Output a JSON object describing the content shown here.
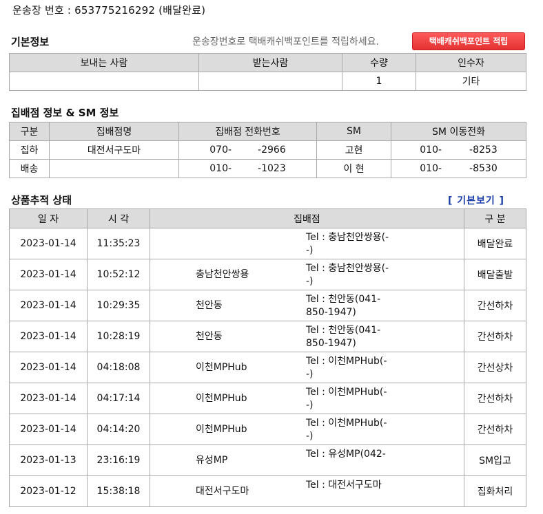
{
  "waybill": {
    "label": "운송장 번호 :",
    "number": "653775216292",
    "status": "(배달완료)"
  },
  "basic": {
    "title": "기본정보",
    "note": "운송장번호로 택배캐쉬백포인트를 적립하세요.",
    "button": "택배캐쉬백포인트 적립",
    "headers": [
      "보내는 사람",
      "받는사람",
      "수량",
      "인수자"
    ],
    "row": {
      "sender": "",
      "receiver": "",
      "qty": "1",
      "acceptor": "기타"
    }
  },
  "branch": {
    "title": "집배점 정보 & SM 정보",
    "headers": [
      "구분",
      "집배점명",
      "집배점 전화번호",
      "SM",
      "SM 이동전화"
    ],
    "rows": [
      {
        "type": "집하",
        "name": "대전서구도마",
        "tel_a": "070-",
        "tel_b": "-2966",
        "sm": "고현",
        "sm_tel_a": "010-",
        "sm_tel_b": "-8253"
      },
      {
        "type": "배송",
        "name": "",
        "tel_a": "010-",
        "tel_b": "-1023",
        "sm": "이 현",
        "sm_tel_a": "010-",
        "sm_tel_b": "-8530"
      }
    ]
  },
  "tracking": {
    "title": "상품추적 상태",
    "toggle": "[ 기본보기 ]",
    "headers": [
      "일 자",
      "시 각",
      "집배점",
      "구 분"
    ],
    "rows": [
      {
        "date": "2023-01-14",
        "time": "11:35:23",
        "hub": "",
        "tel": "Tel : 충남천안쌍용(-\n-)",
        "status": "배달완료"
      },
      {
        "date": "2023-01-14",
        "time": "10:52:12",
        "hub": "충남천안쌍용",
        "tel": "Tel : 충남천안쌍용(-\n-)",
        "status": "배달출발"
      },
      {
        "date": "2023-01-14",
        "time": "10:29:35",
        "hub": "천안동",
        "tel": "Tel : 천안동(041-\n850-1947)",
        "status": "간선하차"
      },
      {
        "date": "2023-01-14",
        "time": "10:28:19",
        "hub": "천안동",
        "tel": "Tel : 천안동(041-\n850-1947)",
        "status": "간선하차"
      },
      {
        "date": "2023-01-14",
        "time": "04:18:08",
        "hub": "이천MPHub",
        "tel": "Tel : 이천MPHub(-\n-)",
        "status": "간선상차"
      },
      {
        "date": "2023-01-14",
        "time": "04:17:14",
        "hub": "이천MPHub",
        "tel": "Tel : 이천MPHub(-\n-)",
        "status": "간선하차"
      },
      {
        "date": "2023-01-14",
        "time": "04:14:20",
        "hub": "이천MPHub",
        "tel": "Tel : 이천MPHub(-\n-)",
        "status": "간선하차"
      },
      {
        "date": "2023-01-13",
        "time": "23:16:19",
        "hub": "유성MP",
        "tel": "Tel : 유성MP(042-",
        "status": "SM입고"
      },
      {
        "date": "2023-01-12",
        "time": "15:38:18",
        "hub": "대전서구도마",
        "tel": "Tel : 대전서구도마",
        "status": "집화처리"
      }
    ]
  }
}
